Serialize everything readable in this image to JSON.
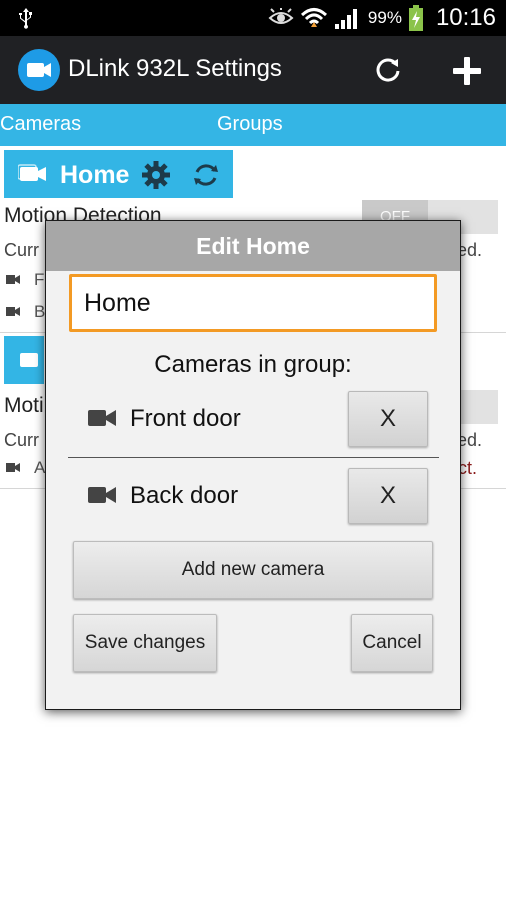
{
  "status_bar": {
    "battery_percent": "99%",
    "time": "10:16",
    "icons": [
      "usb-icon",
      "eye-icon",
      "wifi-icon",
      "signal-icon",
      "battery-charging-icon"
    ]
  },
  "action_bar": {
    "title": "DLink 932L Settings",
    "icons": [
      "app-camera-icon",
      "refresh-icon",
      "add-icon"
    ]
  },
  "tabs": [
    {
      "label": "Cameras"
    },
    {
      "label": "Groups"
    }
  ],
  "background_list": {
    "group_title": "Home",
    "motion_label": "Motion Detection",
    "toggle_label": "OFF",
    "current_prefix": "Curr",
    "current_suffix": "ed.",
    "camera_initials": [
      "F",
      "B",
      "A"
    ],
    "second_motion_prefix": "Moti",
    "second_current_prefix": "Curr",
    "second_current_suffix": "ed.",
    "error_suffix": "ct."
  },
  "dialog": {
    "title": "Edit Home",
    "name_value": "Home",
    "cameras_label": "Cameras in group:",
    "cameras": [
      {
        "name": "Front door",
        "remove_label": "X"
      },
      {
        "name": "Back door",
        "remove_label": "X"
      }
    ],
    "add_camera_label": "Add new camera",
    "save_label": "Save changes",
    "cancel_label": "Cancel"
  },
  "colors": {
    "accent": "#33b5e5",
    "action_bar": "#202124",
    "input_focus": "#f39a24",
    "dialog_title_bg": "#a7a7a7",
    "error_text": "#8b1a1a"
  }
}
